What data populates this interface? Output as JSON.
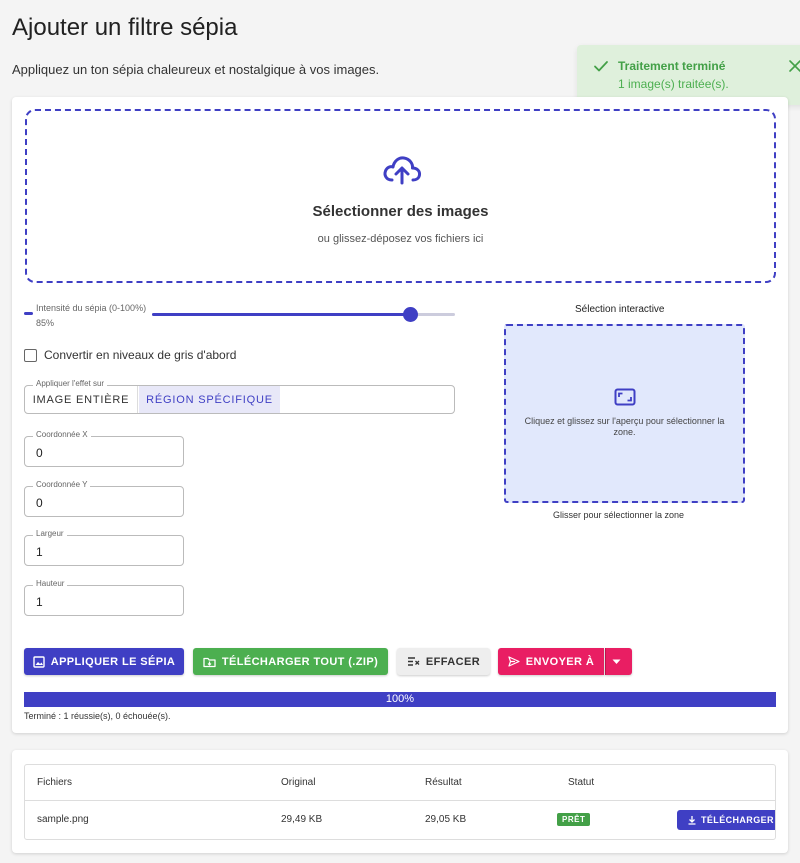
{
  "page": {
    "title": "Ajouter un filtre sépia",
    "subtitle": "Appliquez un ton sépia chaleureux et nostalgique à vos images."
  },
  "toast": {
    "title": "Traitement terminé",
    "message": "1 image(s) traitée(s).",
    "icon": "check-icon",
    "close_icon": "close-icon",
    "color": "#43a047"
  },
  "dropzone": {
    "title": "Sélectionner des images",
    "subtitle": "ou glissez-déposez vos fichiers ici",
    "icon": "cloud-upload-icon"
  },
  "intensity": {
    "label": "Intensité du sépia (0-100%)",
    "value_text": "85%",
    "value": 85
  },
  "grayscale": {
    "label": "Convertir en niveaux de gris d'abord",
    "checked": false
  },
  "apply_to": {
    "legend": "Appliquer l'effet sur",
    "options": [
      "IMAGE ENTIÈRE",
      "RÉGION SPÉCIFIQUE"
    ],
    "selected": "RÉGION SPÉCIFIQUE"
  },
  "fields": {
    "x": {
      "label": "Coordonnée X",
      "value": "0"
    },
    "y": {
      "label": "Coordonnée Y",
      "value": "0"
    },
    "width": {
      "label": "Largeur",
      "value": "1"
    },
    "height": {
      "label": "Hauteur",
      "value": "1"
    }
  },
  "selection": {
    "title": "Sélection interactive",
    "hint": "Cliquez et glissez sur l'aperçu pour sélectionner la zone.",
    "caption": "Glisser pour sélectionner la zone",
    "icon": "crop-icon"
  },
  "actions": {
    "apply": "APPLIQUER LE SÉPIA",
    "download_all": "TÉLÉCHARGER TOUT (.ZIP)",
    "clear": "EFFACER",
    "send_to": "ENVOYER À"
  },
  "progress": {
    "value": 100,
    "text": "100%",
    "status": "Terminé : 1 réussie(s), 0 échouée(s)."
  },
  "table": {
    "headers": [
      "Fichiers",
      "Original",
      "Résultat",
      "Statut"
    ],
    "rows": [
      {
        "file": "sample.png",
        "original": "29,49 KB",
        "result": "29,05 KB",
        "status": "PRÊT",
        "action": "TÉLÉCHARGER"
      }
    ]
  },
  "colors": {
    "primary": "#3f3fc4",
    "success": "#4caf50",
    "pink": "#e91e63"
  }
}
